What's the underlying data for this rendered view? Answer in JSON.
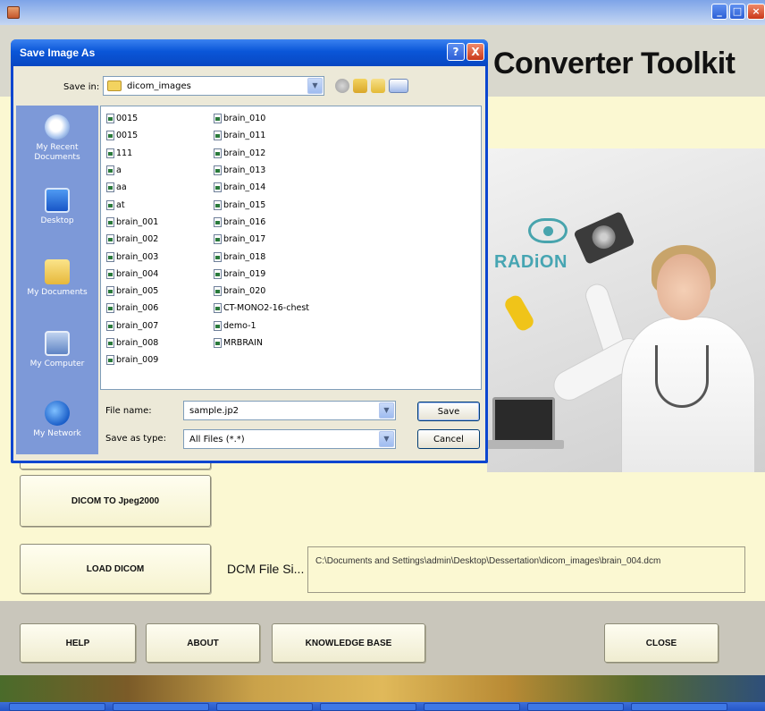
{
  "app": {
    "title": "Converter Toolkit",
    "buttons": {
      "jpeg2000": "DICOM TO Jpeg2000",
      "load_dicom": "LOAD DICOM",
      "help": "HELP",
      "about": "ABOUT",
      "knowledge_base": "KNOWLEDGE BASE",
      "close": "CLOSE"
    },
    "dcm_file_label": "DCM File Si...",
    "dcm_file_path": "C:\\Documents and Settings\\admin\\Desktop\\Dessertation\\dicom_images\\brain_004.dcm",
    "hero": {
      "logo_text": "RADiON"
    }
  },
  "dialog": {
    "title": "Save Image As",
    "save_in_label": "Save in:",
    "save_in_value": "dicom_images",
    "places": [
      "My Recent Documents",
      "Desktop",
      "My Documents",
      "My Computer",
      "My Network"
    ],
    "files_col1": [
      "0015",
      "0015",
      "111",
      "a",
      "aa",
      "at",
      "brain_001",
      "brain_002",
      "brain_003",
      "brain_004",
      "brain_005",
      "brain_006",
      "brain_007",
      "brain_008",
      "brain_009"
    ],
    "files_col2": [
      "brain_010",
      "brain_011",
      "brain_012",
      "brain_013",
      "brain_014",
      "brain_015",
      "brain_016",
      "brain_017",
      "brain_018",
      "brain_019",
      "brain_020",
      "CT-MONO2-16-chest",
      "demo-1",
      "MRBRAIN"
    ],
    "file_name_label": "File name:",
    "file_name_value": "sample.jp2",
    "save_as_type_label": "Save as type:",
    "save_as_type_value": "All Files (*.*)",
    "save_button": "Save",
    "cancel_button": "Cancel",
    "help_glyph": "?",
    "close_glyph": "X"
  }
}
